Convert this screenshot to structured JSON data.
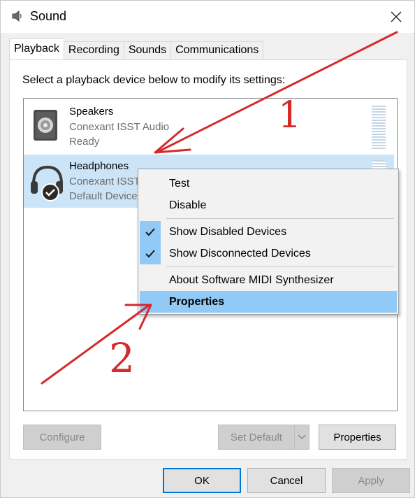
{
  "window": {
    "title": "Sound",
    "title_icon": "speaker-icon",
    "close_icon": "close-icon"
  },
  "tabs": [
    {
      "label": "Playback",
      "active": true
    },
    {
      "label": "Recording",
      "active": false
    },
    {
      "label": "Sounds",
      "active": false
    },
    {
      "label": "Communications",
      "active": false
    }
  ],
  "panel": {
    "instructions": "Select a playback device below to modify its settings:"
  },
  "devices": [
    {
      "name": "Speakers",
      "driver": "Conexant ISST Audio",
      "status": "Ready",
      "icon": "speaker-device-icon",
      "selected": false
    },
    {
      "name": "Headphones",
      "driver": "Conexant ISST",
      "status": "Default Device",
      "icon": "headphones-device-icon",
      "selected": true
    }
  ],
  "context_menu": {
    "items": [
      {
        "label": "Test",
        "checked": false,
        "highlighted": false
      },
      {
        "label": "Disable",
        "checked": false,
        "highlighted": false
      },
      {
        "label": "Show Disabled Devices",
        "checked": true,
        "highlighted": false
      },
      {
        "label": "Show Disconnected Devices",
        "checked": true,
        "highlighted": false
      },
      {
        "label": "About Software MIDI Synthesizer",
        "checked": false,
        "highlighted": false
      },
      {
        "label": "Properties",
        "checked": false,
        "highlighted": true
      }
    ]
  },
  "panel_buttons": {
    "configure": "Configure",
    "set_default": "Set Default",
    "properties": "Properties"
  },
  "dialog_buttons": {
    "ok": "OK",
    "cancel": "Cancel",
    "apply": "Apply"
  },
  "annotations": {
    "label_1": "1",
    "label_2": "2",
    "color": "#d42a2a"
  },
  "colors": {
    "selection": "#cce4f7",
    "menu_highlight": "#91c9f7",
    "accent": "#0078d7"
  }
}
